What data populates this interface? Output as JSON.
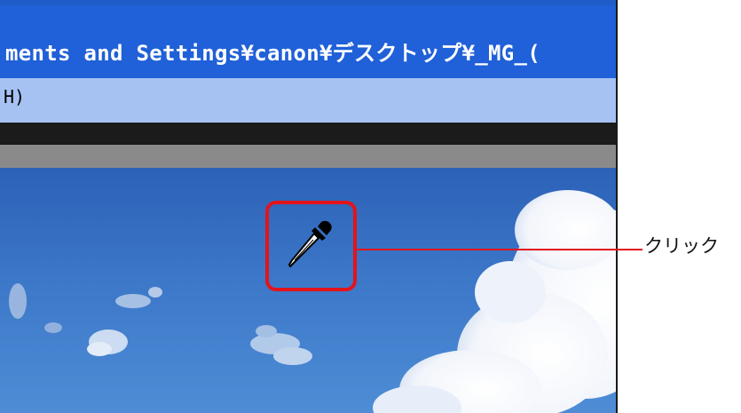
{
  "window": {
    "title": "ments and Settings¥canon¥デスクトップ¥_MG_(",
    "menu_fragment": "H)"
  },
  "tool": {
    "icon": "eyedropper-icon"
  },
  "annotation": {
    "label": "クリック",
    "color": "#e3141b"
  }
}
